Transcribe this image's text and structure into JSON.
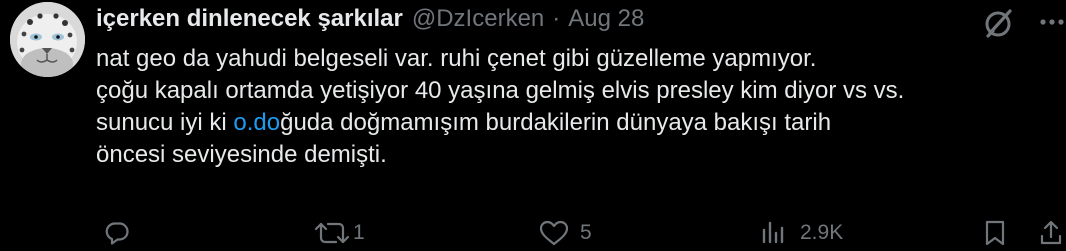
{
  "author": {
    "display_name": "içerken dinlenecek şarkılar",
    "handle": "@DzIcerken",
    "separator": "·",
    "date": "Aug 28"
  },
  "tweet": {
    "line1": "nat geo da yahudi belgeseli var. ruhi çenet gibi güzelleme yapmıyor.",
    "line2": "çoğu kapalı ortamda yetişiyor 40 yaşına gelmiş elvis presley kim diyor vs vs.",
    "line3_before": "sunucu iyi ki ",
    "line3_mention": "o.do",
    "line3_after": "ğuda doğmamışım burdakilerin dünyaya bakışı tarih",
    "line4": "öncesi seviyesinde demişti."
  },
  "actions": {
    "reply_count": "",
    "retweet_count": "1",
    "like_count": "5",
    "views_count": "2.9K"
  },
  "icons": {
    "avatar": "snow-leopard-avatar",
    "grok": "grok-icon",
    "more": "more-icon",
    "reply": "reply-icon",
    "retweet": "retweet-icon",
    "like": "heart-icon",
    "views": "views-icon",
    "bookmark": "bookmark-icon",
    "share": "share-icon"
  },
  "colors": {
    "background": "#000000",
    "text": "#e7e9ea",
    "secondary": "#71767b",
    "link": "#1d9bf0"
  }
}
